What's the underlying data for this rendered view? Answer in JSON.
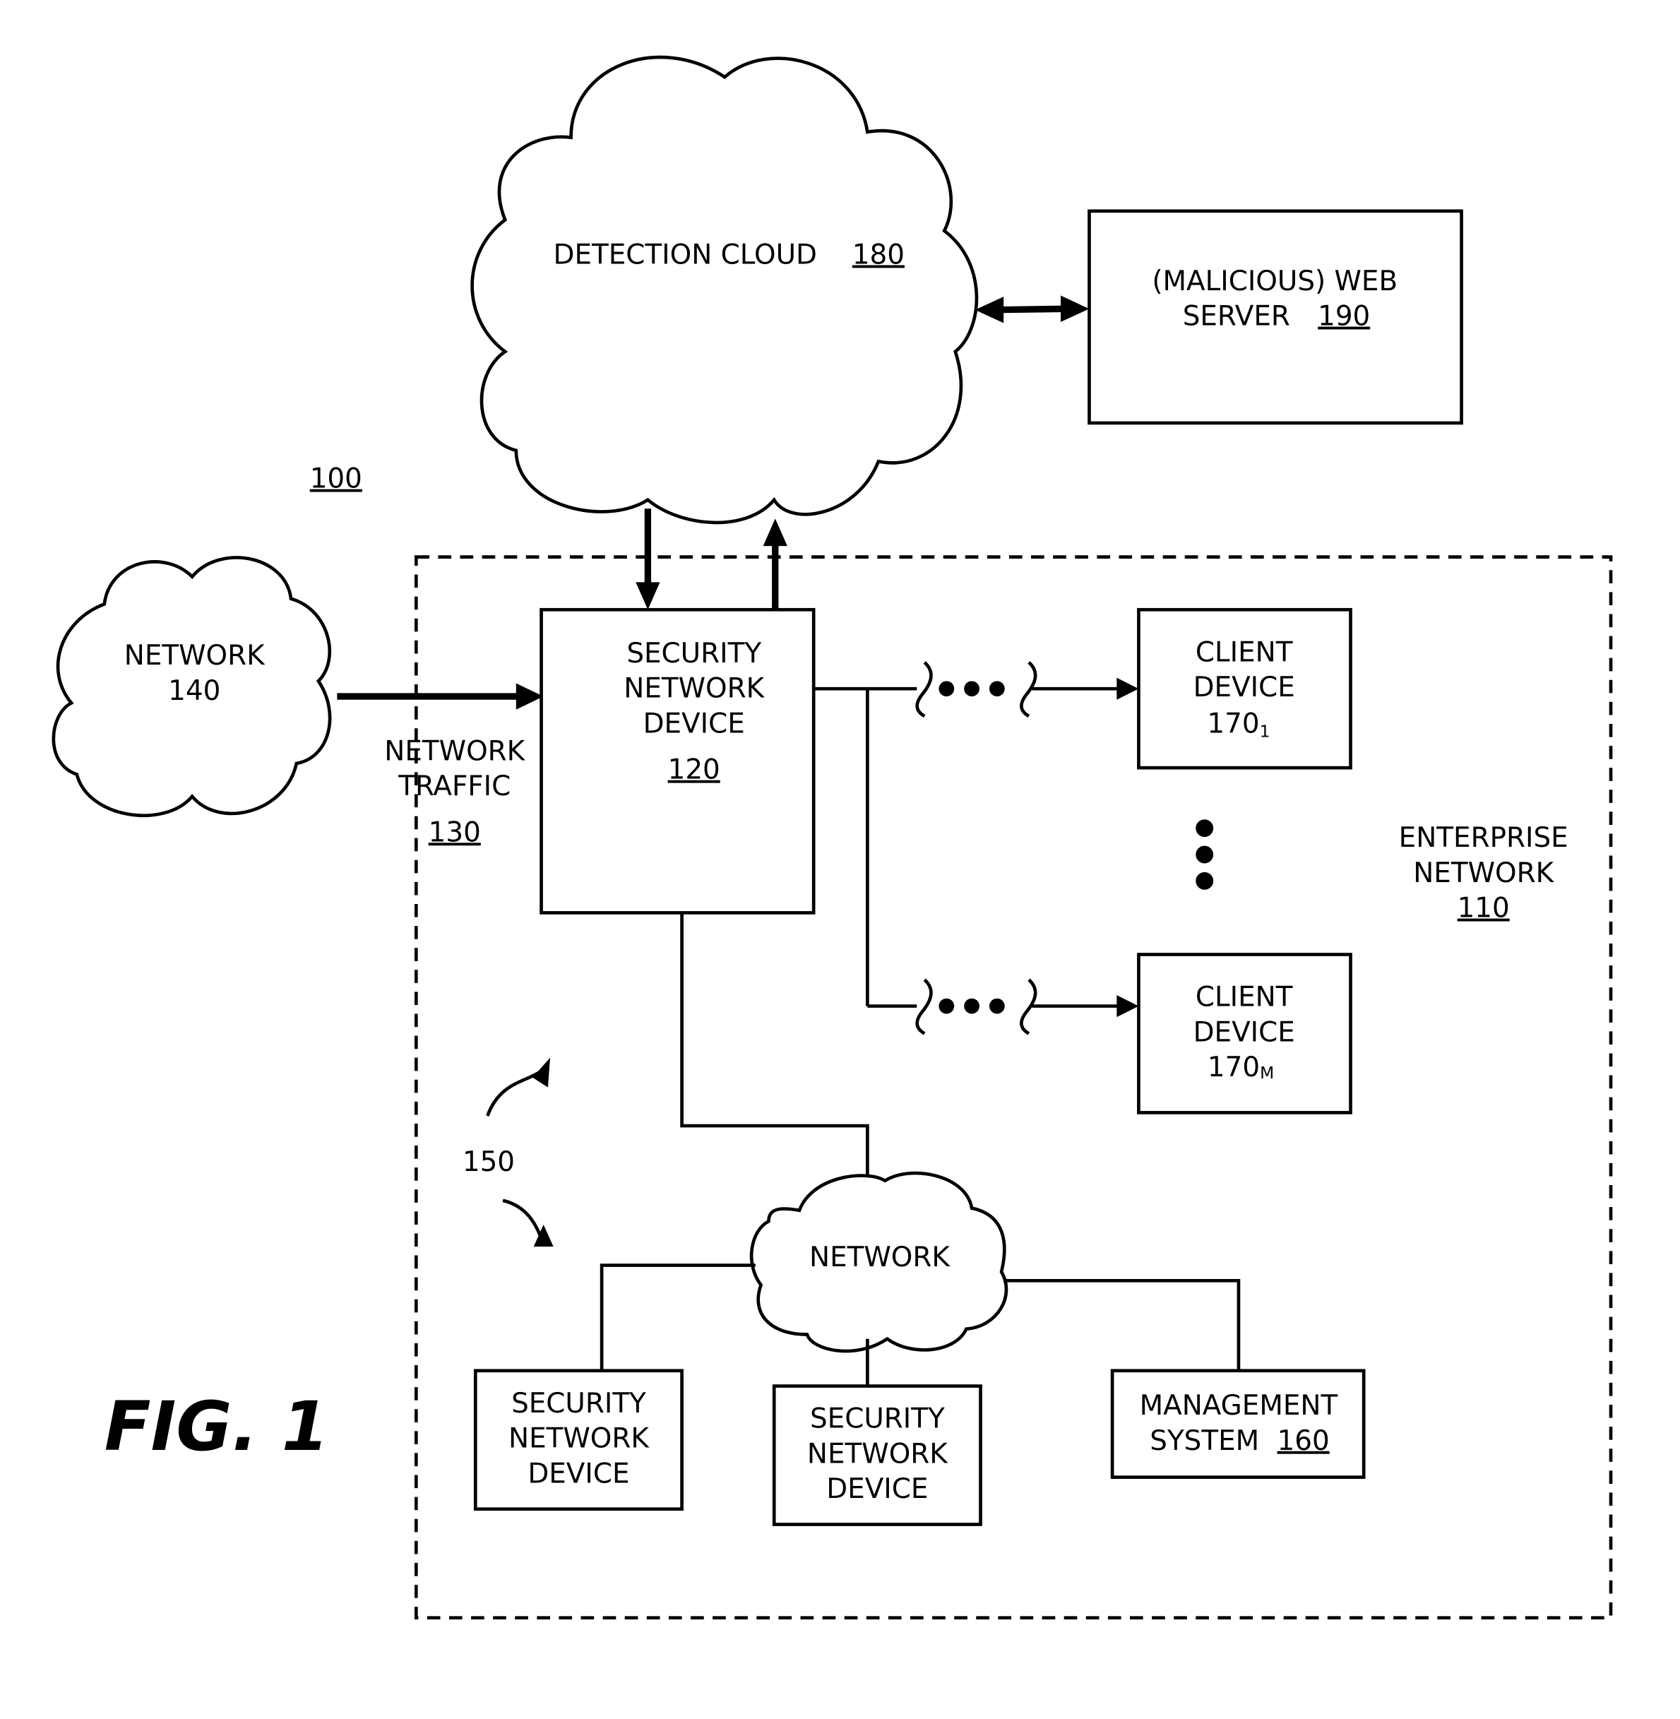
{
  "figure": {
    "system_ref": "100",
    "caption": "FIG. 1",
    "colors": {
      "ink": "#000000",
      "background": "#ffffff"
    }
  },
  "nodes": {
    "detection_cloud": {
      "label": "DETECTION CLOUD",
      "ref": "180"
    },
    "web_server": {
      "lines": [
        "(MALICIOUS) WEB",
        "SERVER"
      ],
      "ref": "190"
    },
    "network_140": {
      "lines": [
        "NETWORK",
        "140"
      ]
    },
    "network_traffic": {
      "lines": [
        "NETWORK",
        "TRAFFIC"
      ],
      "ref": "130"
    },
    "security_device_120": {
      "lines": [
        "SECURITY",
        "NETWORK",
        "DEVICE"
      ],
      "ref": "120"
    },
    "client_device_1": {
      "lines": [
        "CLIENT",
        "DEVICE"
      ],
      "ref": "170",
      "subscript": "1"
    },
    "client_device_m": {
      "lines": [
        "CLIENT",
        "DEVICE"
      ],
      "ref": "170",
      "subscript": "M"
    },
    "enterprise_network": {
      "lines": [
        "ENTERPRISE",
        "NETWORK"
      ],
      "ref": "110"
    },
    "internal_network": {
      "label": "NETWORK"
    },
    "security_device_a": {
      "lines": [
        "SECURITY",
        "NETWORK",
        "DEVICE"
      ]
    },
    "security_device_b": {
      "lines": [
        "SECURITY",
        "NETWORK",
        "DEVICE"
      ]
    },
    "management_system": {
      "lines": [
        "MANAGEMENT",
        "SYSTEM"
      ],
      "ref": "160"
    },
    "security_devices_group": {
      "ref": "150"
    }
  }
}
